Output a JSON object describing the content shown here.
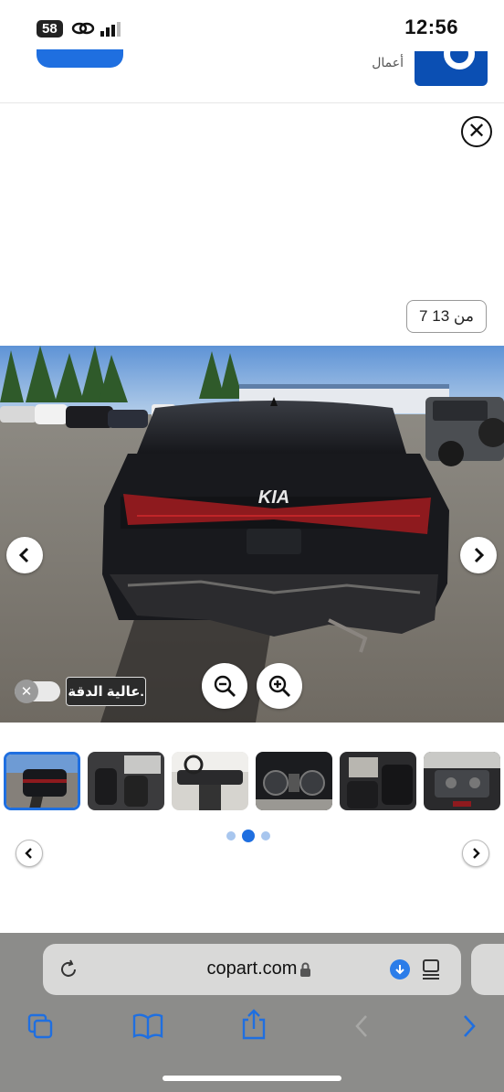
{
  "status_bar": {
    "time": "12:56",
    "badge": "58"
  },
  "header": {
    "text": "أعمال"
  },
  "viewer": {
    "counter": "من 13 7",
    "hd_label": "عالية الدقة.",
    "thumbnails": [
      {
        "name": "rear-exterior",
        "active": true
      },
      {
        "name": "front-seats",
        "active": false
      },
      {
        "name": "dashboard",
        "active": false
      },
      {
        "name": "instrument-cluster",
        "active": false
      },
      {
        "name": "rear-seat",
        "active": false
      },
      {
        "name": "engine-bay",
        "active": false
      }
    ],
    "page_dots": 3,
    "active_dot": 2
  },
  "browser": {
    "url": "copart.com"
  },
  "icons": {
    "close": "close-icon",
    "prev": "chevron-left-icon",
    "next": "chevron-right-icon",
    "zoom_out": "zoom-out-icon",
    "zoom_in": "zoom-in-icon",
    "reload": "reload-icon",
    "lock": "lock-icon",
    "download": "download-icon",
    "reader": "reader-icon",
    "tabs": "tabs-icon",
    "bookmarks": "bookmarks-icon",
    "share": "share-icon",
    "back": "back-arrow-icon",
    "forward": "forward-arrow-icon"
  },
  "colors": {
    "accent": "#1f6fe0",
    "brand": "#0b4fb3",
    "browser_bg": "#8c8c8a"
  }
}
